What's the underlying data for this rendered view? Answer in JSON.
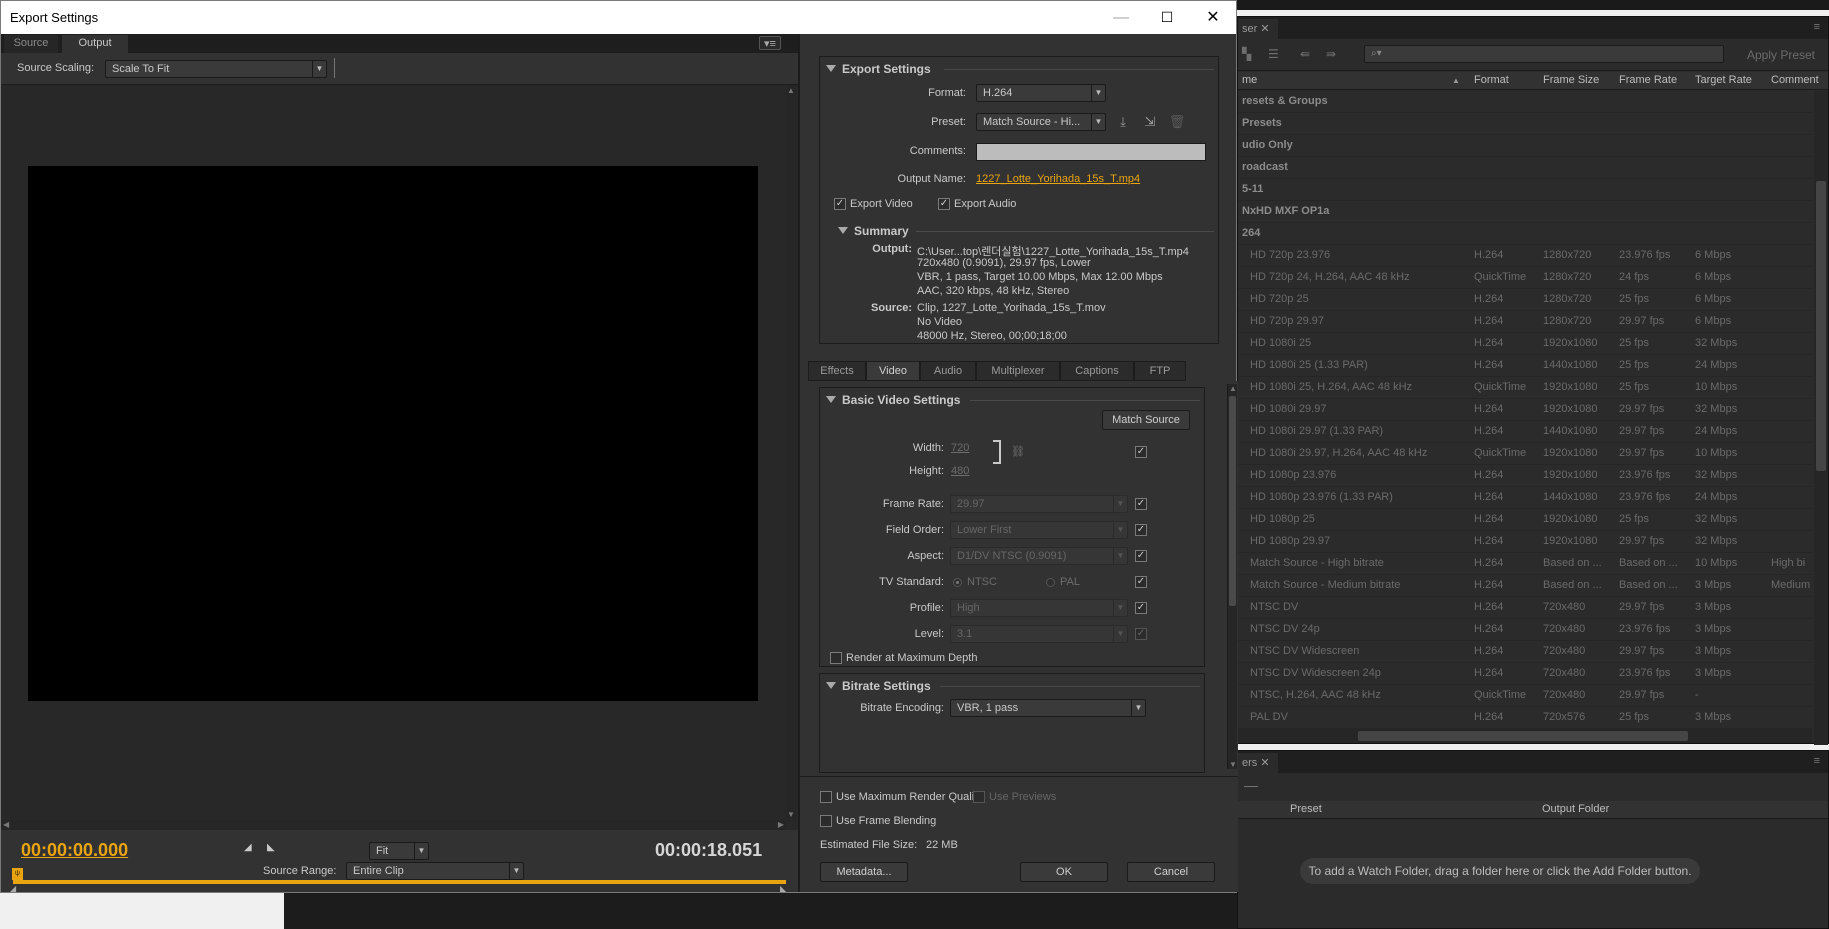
{
  "dialog": {
    "title": "Export Settings",
    "controls": {
      "minimize": "—",
      "maximize": "☐",
      "close": "✕"
    }
  },
  "left": {
    "tabs": {
      "source": "Source",
      "output": "Output"
    },
    "menu_glyph": "▾≡",
    "source_scaling": {
      "label": "Source Scaling:",
      "value": "Scale To Fit"
    },
    "timecode_in": "00:00:00.000",
    "timecode_duration": "00:00:18.051",
    "zoom": "Fit",
    "source_range": {
      "label": "Source Range:",
      "value": "Entire Clip"
    },
    "playhead_glyph": "ψ"
  },
  "export_settings": {
    "title": "Export Settings",
    "format": {
      "label": "Format:",
      "value": "H.264"
    },
    "preset": {
      "label": "Preset:",
      "value": "Match Source - Hi..."
    },
    "comments": {
      "label": "Comments:",
      "value": ""
    },
    "output_name": {
      "label": "Output Name:",
      "value": "1227_Lotte_Yorihada_15s_T.mp4"
    },
    "export_video": {
      "label": "Export Video",
      "checked": true
    },
    "export_audio": {
      "label": "Export Audio",
      "checked": true
    }
  },
  "summary": {
    "title": "Summary",
    "output_label": "Output:",
    "output_lines": [
      "C:\\User...top\\렌더실험\\1227_Lotte_Yorihada_15s_T.mp4",
      "720x480 (0.9091), 29.97 fps, Lower",
      "VBR, 1 pass, Target 10.00 Mbps, Max 12.00 Mbps",
      "AAC, 320 kbps, 48 kHz, Stereo"
    ],
    "source_label": "Source:",
    "source_lines": [
      "Clip, 1227_Lotte_Yorihada_15s_T.mov",
      "No Video",
      "48000 Hz, Stereo, 00;00;18;00"
    ]
  },
  "settings_tabs": [
    "Effects",
    "Video",
    "Audio",
    "Multiplexer",
    "Captions",
    "FTP"
  ],
  "settings_tabs_active": "Video",
  "basic_video": {
    "title": "Basic Video Settings",
    "match_source": "Match Source",
    "width": {
      "label": "Width:",
      "value": "720"
    },
    "height": {
      "label": "Height:",
      "value": "480"
    },
    "frame_rate": {
      "label": "Frame Rate:",
      "value": "29.97"
    },
    "field_order": {
      "label": "Field Order:",
      "value": "Lower First"
    },
    "aspect": {
      "label": "Aspect:",
      "value": "D1/DV NTSC (0.9091)"
    },
    "tv_standard": {
      "label": "TV Standard:",
      "ntsc": "NTSC",
      "pal": "PAL"
    },
    "profile": {
      "label": "Profile:",
      "value": "High"
    },
    "level": {
      "label": "Level:",
      "value": "3.1"
    },
    "render_max_depth": "Render at Maximum Depth"
  },
  "bitrate": {
    "title": "Bitrate Settings",
    "encoding": {
      "label": "Bitrate Encoding:",
      "value": "VBR, 1 pass"
    }
  },
  "footer": {
    "max_render_quality": "Use Maximum Render Quality",
    "use_previews": "Use Previews",
    "frame_blending": "Use Frame Blending",
    "estimated_size_label": "Estimated File Size:",
    "estimated_size_value": "22 MB",
    "metadata": "Metadata...",
    "ok": "OK",
    "cancel": "Cancel"
  },
  "preset_browser": {
    "tab_label": "ser",
    "search_placeholder": "",
    "apply_preset": "Apply Preset",
    "columns": {
      "name": "me",
      "format": "Format",
      "frame_size": "Frame Size",
      "frame_rate": "Frame Rate",
      "target_rate": "Target Rate",
      "comment": "Comment"
    },
    "groups": [
      "resets & Groups",
      "Presets",
      "udio Only",
      "roadcast",
      "5-11",
      "NxHD MXF OP1a",
      "264"
    ],
    "items": [
      {
        "name": "HD 720p 23.976",
        "format": "H.264",
        "size": "1280x720",
        "rate": "23.976 fps",
        "target": "6 Mbps",
        "comment": ""
      },
      {
        "name": "HD 720p 24, H.264, AAC 48 kHz",
        "format": "QuickTime",
        "size": "1280x720",
        "rate": "24 fps",
        "target": "6 Mbps",
        "comment": ""
      },
      {
        "name": "HD 720p 25",
        "format": "H.264",
        "size": "1280x720",
        "rate": "25 fps",
        "target": "6 Mbps",
        "comment": ""
      },
      {
        "name": "HD 720p 29.97",
        "format": "H.264",
        "size": "1280x720",
        "rate": "29.97 fps",
        "target": "6 Mbps",
        "comment": ""
      },
      {
        "name": "HD 1080i 25",
        "format": "H.264",
        "size": "1920x1080",
        "rate": "25 fps",
        "target": "32 Mbps",
        "comment": ""
      },
      {
        "name": "HD 1080i 25 (1.33 PAR)",
        "format": "H.264",
        "size": "1440x1080",
        "rate": "25 fps",
        "target": "24 Mbps",
        "comment": ""
      },
      {
        "name": "HD 1080i 25, H.264, AAC 48 kHz",
        "format": "QuickTime",
        "size": "1920x1080",
        "rate": "25 fps",
        "target": "10 Mbps",
        "comment": ""
      },
      {
        "name": "HD 1080i 29.97",
        "format": "H.264",
        "size": "1920x1080",
        "rate": "29.97 fps",
        "target": "32 Mbps",
        "comment": ""
      },
      {
        "name": "HD 1080i 29.97 (1.33 PAR)",
        "format": "H.264",
        "size": "1440x1080",
        "rate": "29.97 fps",
        "target": "24 Mbps",
        "comment": ""
      },
      {
        "name": "HD 1080i 29.97, H.264, AAC 48 kHz",
        "format": "QuickTime",
        "size": "1920x1080",
        "rate": "29.97 fps",
        "target": "10 Mbps",
        "comment": ""
      },
      {
        "name": "HD 1080p 23.976",
        "format": "H.264",
        "size": "1920x1080",
        "rate": "23.976 fps",
        "target": "32 Mbps",
        "comment": ""
      },
      {
        "name": "HD 1080p 23.976 (1.33 PAR)",
        "format": "H.264",
        "size": "1440x1080",
        "rate": "23.976 fps",
        "target": "24 Mbps",
        "comment": ""
      },
      {
        "name": "HD 1080p 25",
        "format": "H.264",
        "size": "1920x1080",
        "rate": "25 fps",
        "target": "32 Mbps",
        "comment": ""
      },
      {
        "name": "HD 1080p 29.97",
        "format": "H.264",
        "size": "1920x1080",
        "rate": "29.97 fps",
        "target": "32 Mbps",
        "comment": ""
      },
      {
        "name": "Match Source - High bitrate",
        "format": "H.264",
        "size": "Based on ...",
        "rate": "Based on ...",
        "target": "10 Mbps",
        "comment": "High bi"
      },
      {
        "name": "Match Source - Medium bitrate",
        "format": "H.264",
        "size": "Based on ...",
        "rate": "Based on ...",
        "target": "3 Mbps",
        "comment": "Medium"
      },
      {
        "name": "NTSC DV",
        "format": "H.264",
        "size": "720x480",
        "rate": "29.97 fps",
        "target": "3 Mbps",
        "comment": ""
      },
      {
        "name": "NTSC DV 24p",
        "format": "H.264",
        "size": "720x480",
        "rate": "23.976 fps",
        "target": "3 Mbps",
        "comment": ""
      },
      {
        "name": "NTSC DV Widescreen",
        "format": "H.264",
        "size": "720x480",
        "rate": "29.97 fps",
        "target": "3 Mbps",
        "comment": ""
      },
      {
        "name": "NTSC DV Widescreen 24p",
        "format": "H.264",
        "size": "720x480",
        "rate": "23.976 fps",
        "target": "3 Mbps",
        "comment": ""
      },
      {
        "name": "NTSC, H.264, AAC 48 kHz",
        "format": "QuickTime",
        "size": "720x480",
        "rate": "29.97 fps",
        "target": "-",
        "comment": ""
      },
      {
        "name": "PAL DV",
        "format": "H.264",
        "size": "720x576",
        "rate": "25 fps",
        "target": "3 Mbps",
        "comment": ""
      }
    ]
  },
  "watch_folders": {
    "tab_label": "ers",
    "columns": {
      "preset": "Preset",
      "output_folder": "Output Folder"
    },
    "hint": "To add a Watch Folder, drag a folder here or click the Add Folder button."
  }
}
